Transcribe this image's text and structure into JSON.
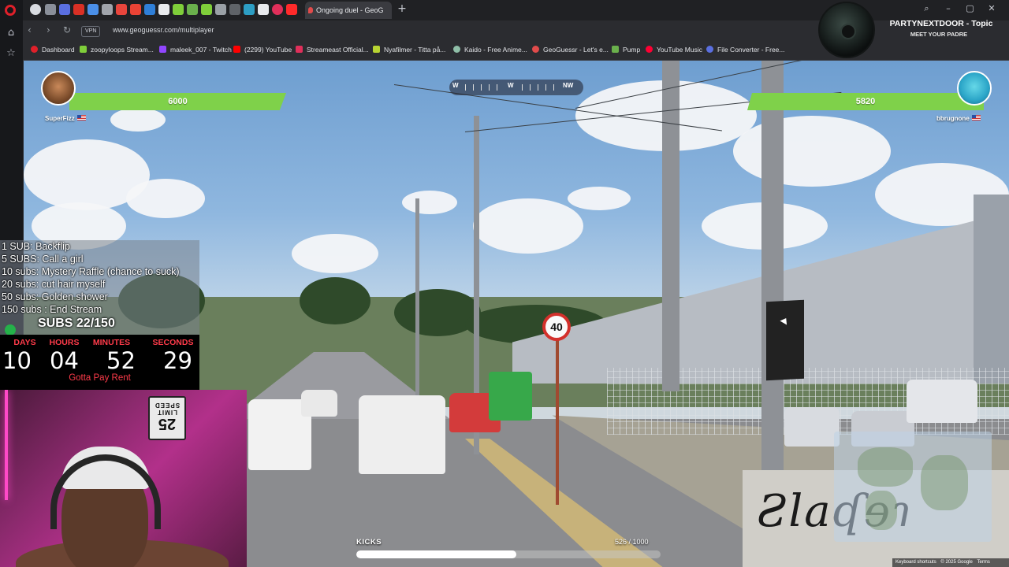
{
  "browser": {
    "active_tab_title": "Ongoing duel - GeoG",
    "url": "www.geoguessr.com/multiplayer",
    "vpn_label": "VPN",
    "bookmarks": [
      "Dashboard",
      "zoopyloops Stream...",
      "maleek_007 - Twitch",
      "(2299) YouTube",
      "Streameast Official...",
      "Nyafilmer - Titta på...",
      "Kaido - Free Anime...",
      "GeoGuessr - Let's e...",
      "Pump",
      "YouTube Music",
      "File Converter - Free..."
    ]
  },
  "now_playing": {
    "title": "PARTYNEXTDOOR - Topic",
    "subtitle": "MEET YOUR PADRE"
  },
  "duel": {
    "compass": {
      "letters": [
        "W",
        "W",
        "NW"
      ]
    },
    "player1": {
      "name": "SuperFizz",
      "health": "6000"
    },
    "player2": {
      "name": "bbrugnone",
      "health": "5820"
    }
  },
  "street_view": {
    "speed_sign": "40",
    "graffiti": "Ƨlaʠɘɿ"
  },
  "stream": {
    "goals": [
      "1 SUB: Backflip",
      "5 SUBS: Call a girl",
      "10 subs: Mystery Raffle (chance to suck)",
      "20 subs: cut hair myself",
      "50 subs: Golden shower",
      "150 subs : End Stream"
    ],
    "subs_counter": "SUBS 22/150",
    "countdown": {
      "labels": [
        "DAYS",
        "HOURS",
        "MINUTES",
        "SECONDS"
      ],
      "values": [
        "10",
        "04",
        "52",
        "29"
      ],
      "caption": "Gotta Pay Rent"
    },
    "webcam_sign": {
      "line1": "SPEED",
      "line2": "LIMIT",
      "number": "25"
    }
  },
  "kicks": {
    "label": "KICKS",
    "count": "526 / 1000",
    "progress": 0.526
  },
  "footer": {
    "keyboard": "Keyboard shortcuts",
    "copyright": "© 2025 Google",
    "terms": "Terms"
  },
  "colors": {
    "health_bar": "#7fd14a",
    "countdown_label": "#ff3b4a",
    "opera_red": "#e0202a"
  }
}
